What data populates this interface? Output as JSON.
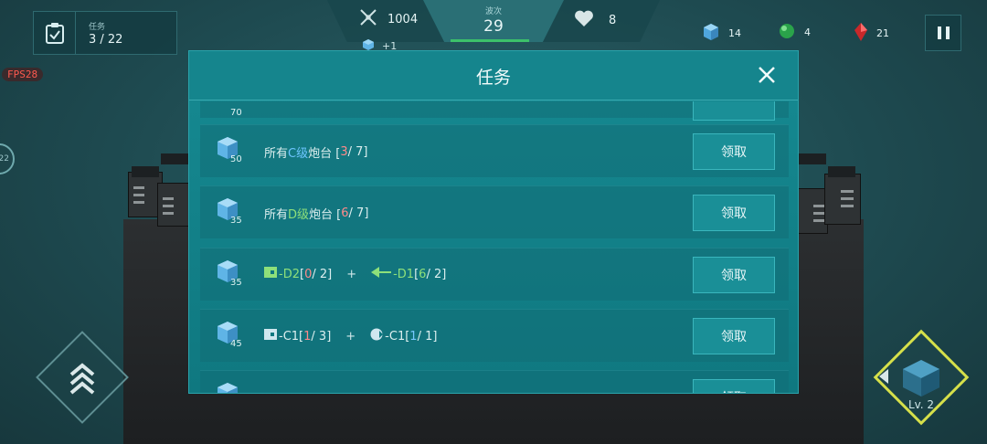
{
  "hud": {
    "task_label": "任务",
    "task_progress": "3 / 22",
    "kills": "1004",
    "kills_bonus": "+1",
    "wave_label": "波次",
    "wave_value": "29",
    "lives": "8",
    "resources": [
      {
        "icon": "blue-cube-icon",
        "value": "14"
      },
      {
        "icon": "green-orb-icon",
        "value": "4"
      },
      {
        "icon": "red-crystal-icon",
        "value": "21"
      }
    ],
    "fps": "FPS28",
    "side_indicator": "22",
    "build_level": "Lv. 2"
  },
  "modal": {
    "title": "任务",
    "top_partial_reward": "70",
    "rows": [
      {
        "reward": "50",
        "pre": "所有",
        "grade": "C级",
        "post": "炮台 [",
        "cur": "3",
        "total": " / 7]",
        "claim": "领取"
      },
      {
        "reward": "35",
        "pre": "所有",
        "grade": "D级",
        "post": "炮台 [",
        "cur": "6",
        "total": " / 7]",
        "claim": "领取"
      },
      {
        "reward": "35",
        "a_name": "-D2",
        "a_open": " [",
        "a_cur": "0",
        "a_total": " / 2]",
        "plus": "+",
        "b_name": "-D1",
        "b_open": " [",
        "b_cur": "6",
        "b_total": " / 2]",
        "claim": "领取"
      },
      {
        "reward": "45",
        "a_name": "-C1",
        "a_open": " [",
        "a_cur": "1",
        "a_total": " / 3]",
        "plus": "+",
        "b_name": "-C1",
        "b_open": " [",
        "b_cur": "1",
        "b_total": " / 1]",
        "claim": "领取"
      },
      {
        "reward": "",
        "claim": "领取"
      }
    ]
  },
  "colors": {
    "modal_bg": "#168a92",
    "highlight_c": "#6ec6ff",
    "highlight_d": "#8ee07a",
    "progress_red": "#ff8a8a",
    "build_border": "#d6e04a",
    "wave_bar": "#3cc16a"
  }
}
